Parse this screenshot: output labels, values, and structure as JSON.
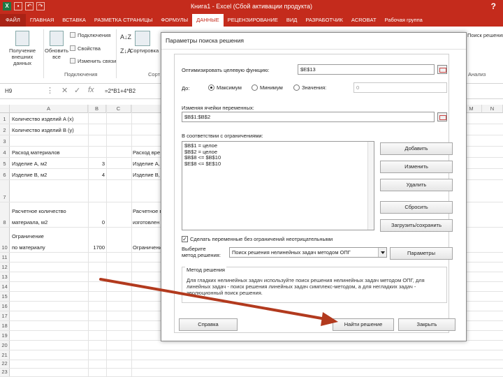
{
  "window": {
    "title": "Книга1 - Excel (Сбой активации продукта)",
    "help": "?"
  },
  "ribbon_tabs": [
    "ФАЙЛ",
    "ГЛАВНАЯ",
    "ВСТАВКА",
    "РАЗМЕТКА СТРАНИЦЫ",
    "ФОРМУЛЫ",
    "ДАННЫЕ",
    "РЕЦЕНЗИРОВАНИЕ",
    "ВИД",
    "РАЗРАБОТЧИК",
    "ACROBAT",
    "Рабочая группа"
  ],
  "ribbon": {
    "get_data": "Получение внешних данных",
    "refresh_all": "Обновить все",
    "connections": "Подключения",
    "properties": "Свойства",
    "edit_links": "Изменить связи",
    "group_connections": "Подключения",
    "sort": "Сортировка",
    "group_sort_letter": "Сорт",
    "solver": "Поиск решения",
    "analysis": "Анализ"
  },
  "formula_bar": {
    "name_box": "H9",
    "formula": "=2*B1+4*B2"
  },
  "sheet": {
    "columns": [
      "A",
      "B",
      "C",
      "M",
      "N"
    ],
    "rows": [
      {
        "n": "1",
        "a": "Количество изделий A (x)",
        "b": "",
        "d": ""
      },
      {
        "n": "2",
        "a": "Количество изделий B (y)",
        "b": "",
        "d": ""
      },
      {
        "n": "3",
        "a": "",
        "b": "",
        "d": ""
      },
      {
        "n": "4",
        "a": "Расход материалов",
        "b": "",
        "d": "Расход вре"
      },
      {
        "n": "5",
        "a": "Изделие A, м2",
        "b": "3",
        "d": "Изделие A,"
      },
      {
        "n": "6",
        "a": "Изделие B, м2",
        "b": "4",
        "d": "Изделие B,"
      },
      {
        "n": "7",
        "a": "",
        "b": "",
        "d": ""
      },
      {
        "n": "8",
        "a": "Расчетное количество",
        "a2": "материала, м2",
        "b": "0",
        "d": "Расчетное в",
        "d2": "изготовлен"
      },
      {
        "n": "9",
        "a": "",
        "b": "",
        "d": ""
      },
      {
        "n": "10",
        "a": "Ограничение",
        "a2": "по материалу",
        "b": "1700",
        "d": "Ограничени"
      },
      {
        "n": "11"
      },
      {
        "n": "12"
      },
      {
        "n": "13"
      },
      {
        "n": "14"
      },
      {
        "n": "15"
      },
      {
        "n": "16"
      },
      {
        "n": "17"
      },
      {
        "n": "18"
      },
      {
        "n": "19"
      },
      {
        "n": "20"
      },
      {
        "n": "21"
      },
      {
        "n": "22"
      },
      {
        "n": "23"
      }
    ]
  },
  "dialog": {
    "title": "Параметры поиска решения",
    "objective_label": "Оптимизировать целевую функцию:",
    "objective_value": "$E$13",
    "to_label": "До:",
    "radio_max": "Максимум",
    "radio_min": "Минимум",
    "radio_value": "Значения:",
    "value_field": "0",
    "changing_label": "Изменяя ячейки переменных:",
    "changing_value": "$B$1:$B$2",
    "constraints_label": "В соответствии с ограничениями:",
    "constraints": [
      "$B$1 = целое",
      "$B$2 = целое",
      "$B$8 <= $B$10",
      "$E$8 <= $E$10"
    ],
    "btn_add": "Добавить",
    "btn_change": "Изменить",
    "btn_delete": "Удалить",
    "btn_reset": "Сбросить",
    "btn_load_save": "Загрузить/сохранить",
    "nonneg_label": "Сделать переменные без ограничений неотрицательными",
    "method_label_1": "Выберите",
    "method_label_2": "метод решения:",
    "method_value": "Поиск решения нелинейных задач методом ОПГ",
    "btn_params": "Параметры",
    "method_group": "Метод решения",
    "method_desc": "Для гладких нелинейных задач используйте поиск решения нелинейных задач методом ОПГ, для линейных задач - поиск решения линейных задач симплекс-методом, а для негладких задач - эволюционный поиск решения.",
    "btn_help": "Справка",
    "btn_solve": "Найти решение",
    "btn_close": "Закрыть"
  },
  "colors": {
    "excel_red": "#c42b1c",
    "annotation_arrow": "#b23a1e"
  }
}
